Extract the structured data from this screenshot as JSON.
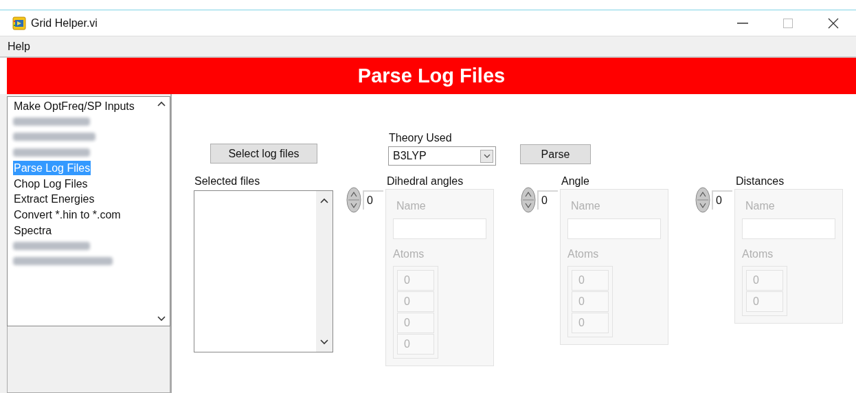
{
  "window": {
    "title": "Grid Helper.vi"
  },
  "menu": [
    {
      "label": "Help"
    }
  ],
  "banner": "Parse Log Files",
  "nav": {
    "items": [
      {
        "kind": "text",
        "label": "Make OptFreq/SP Inputs",
        "selected": false
      },
      {
        "kind": "redacted",
        "selected": false
      },
      {
        "kind": "redacted",
        "selected": false
      },
      {
        "kind": "redacted",
        "selected": false
      },
      {
        "kind": "text",
        "label": "Parse Log Files",
        "selected": true
      },
      {
        "kind": "text",
        "label": "Chop Log Files",
        "selected": false
      },
      {
        "kind": "text",
        "label": "Extract Energies",
        "selected": false
      },
      {
        "kind": "text",
        "label": "Convert *.hin to *.com",
        "selected": false
      },
      {
        "kind": "text",
        "label": "Spectra",
        "selected": false
      },
      {
        "kind": "redacted",
        "selected": false
      },
      {
        "kind": "redacted",
        "selected": false
      }
    ]
  },
  "select_button": "Select log files",
  "theory": {
    "label": "Theory Used",
    "value": "B3LYP"
  },
  "parse_button": "Parse",
  "selected_files": {
    "label": "Selected files"
  },
  "arrays": [
    {
      "label": "Dihedral angles",
      "index": "0",
      "disabled": true,
      "name_label": "Name",
      "atoms_label": "Atoms",
      "atoms": [
        "0",
        "0",
        "0",
        "0"
      ]
    },
    {
      "label": "Angle",
      "index": "0",
      "disabled": true,
      "name_label": "Name",
      "atoms_label": "Atoms",
      "atoms": [
        "0",
        "0",
        "0"
      ]
    },
    {
      "label": "Distances",
      "index": "0",
      "disabled": true,
      "name_label": "Name",
      "atoms_label": "Atoms",
      "atoms": [
        "0",
        "0"
      ]
    }
  ]
}
